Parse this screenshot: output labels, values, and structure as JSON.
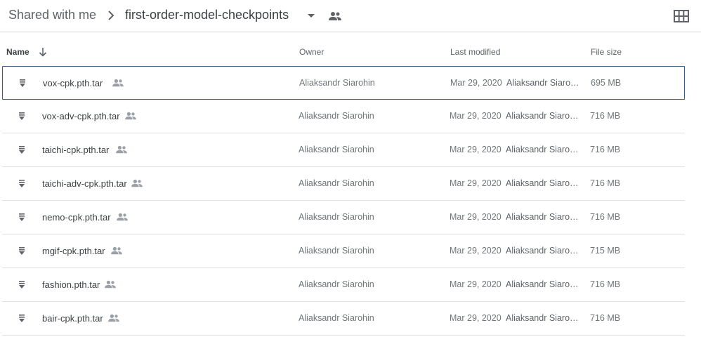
{
  "breadcrumb": {
    "root": "Shared with me",
    "current": "first-order-model-checkpoints"
  },
  "columns": {
    "name": "Name",
    "owner": "Owner",
    "last_modified": "Last modified",
    "file_size": "File size"
  },
  "icons": {
    "separator": "chevron-right-icon",
    "dropdown": "caret-down-icon",
    "shared": "people-icon",
    "view_toggle": "grid-view-icon",
    "sort": "arrow-down-icon",
    "file": "archive-file-icon"
  },
  "colors": {
    "selected_border": "#3b5d80",
    "divider": "#e0e0e0"
  },
  "files": [
    {
      "name": "vox-cpk.pth.tar",
      "owner": "Aliaksandr Siarohin",
      "modified_date": "Mar 29, 2020",
      "modified_by": "Aliaksandr Siarohin",
      "size": "695 MB",
      "selected": true
    },
    {
      "name": "vox-adv-cpk.pth.tar",
      "owner": "Aliaksandr Siarohin",
      "modified_date": "Mar 29, 2020",
      "modified_by": "Aliaksandr Siarohin",
      "size": "716 MB"
    },
    {
      "name": "taichi-cpk.pth.tar",
      "owner": "Aliaksandr Siarohin",
      "modified_date": "Mar 29, 2020",
      "modified_by": "Aliaksandr Siarohin",
      "size": "716 MB"
    },
    {
      "name": "taichi-adv-cpk.pth.tar",
      "owner": "Aliaksandr Siarohin",
      "modified_date": "Mar 29, 2020",
      "modified_by": "Aliaksandr Siarohin",
      "size": "716 MB"
    },
    {
      "name": "nemo-cpk.pth.tar",
      "owner": "Aliaksandr Siarohin",
      "modified_date": "Mar 29, 2020",
      "modified_by": "Aliaksandr Siarohin",
      "size": "716 MB"
    },
    {
      "name": "mgif-cpk.pth.tar",
      "owner": "Aliaksandr Siarohin",
      "modified_date": "Mar 29, 2020",
      "modified_by": "Aliaksandr Siarohin",
      "size": "715 MB"
    },
    {
      "name": "fashion.pth.tar",
      "owner": "Aliaksandr Siarohin",
      "modified_date": "Mar 29, 2020",
      "modified_by": "Aliaksandr Siarohin",
      "size": "716 MB"
    },
    {
      "name": "bair-cpk.pth.tar",
      "owner": "Aliaksandr Siarohin",
      "modified_date": "Mar 29, 2020",
      "modified_by": "Aliaksandr Siarohin",
      "size": "716 MB"
    }
  ]
}
